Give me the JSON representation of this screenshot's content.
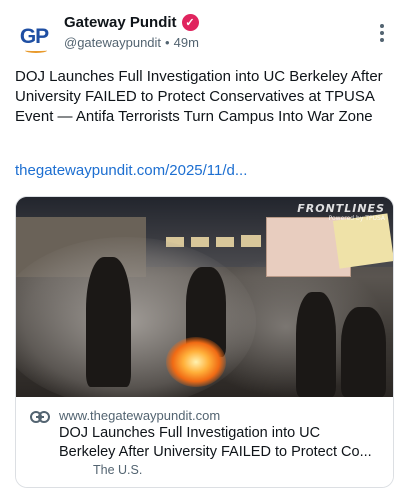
{
  "author": {
    "avatar_text": "GP",
    "display_name": "Gateway Pundit",
    "verified": true,
    "verified_color": "#e0245e",
    "handle": "@gatewaypundit",
    "separator": "•",
    "time": "49m"
  },
  "post": {
    "text": "DOJ Launches Full Investigation into UC Berkeley After University FAILED to Protect Conservatives at TPUSA Event — Antifa Terrorists Turn Campus Into War Zone",
    "link": "thegatewaypundit.com/2025/11/d..."
  },
  "card": {
    "image_watermark": "FRONTLINES",
    "image_watermark_sub": "Powered by TPUSA",
    "domain": "www.thegatewaypundit.com",
    "title_line1": "DOJ Launches Full Investigation into UC",
    "title_line2": "Berkeley After University FAILED to Protect Co...",
    "category": "The U.S."
  },
  "icons": {
    "more": "more-vertical-icon",
    "verified": "verified-badge-icon",
    "link": "link-icon"
  },
  "colors": {
    "link": "#1d6fd1",
    "muted": "#536471",
    "text": "#0f1419"
  }
}
